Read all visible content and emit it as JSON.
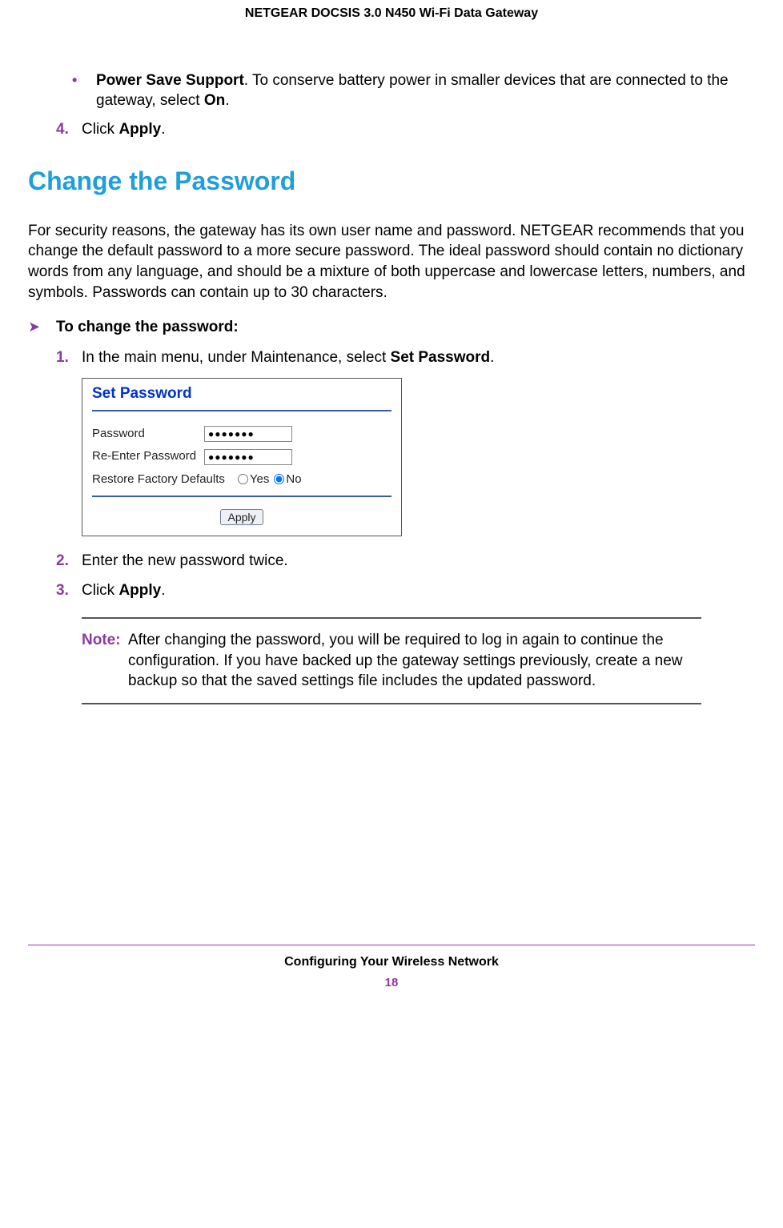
{
  "header": {
    "title": "NETGEAR DOCSIS 3.0 N450 Wi-Fi Data Gateway"
  },
  "bullet": {
    "label": "Power Save Support",
    "text": ". To conserve battery power in smaller devices that are connected to the gateway, select ",
    "on": "On",
    "period": "."
  },
  "step4": {
    "num": "4.",
    "pre": "Click ",
    "bold": "Apply",
    "post": "."
  },
  "heading": "Change the Password",
  "intro": "For security reasons, the gateway has its own user name and password. NETGEAR recommends that you change the default password to a more secure password. The ideal password should contain no dictionary words from any language, and should be a mixture of both uppercase and lowercase letters, numbers, and symbols. Passwords can contain up to 30 characters.",
  "proc": {
    "title": "To change the password:"
  },
  "s1": {
    "num": "1.",
    "pre": "In the main menu, under Maintenance, select ",
    "bold": "Set Password",
    "post": "."
  },
  "screenshot": {
    "title": "Set Password",
    "pw_label": "Password",
    "pw_value": "●●●●●●●",
    "rpw_label": "Re-Enter Password",
    "rpw_value": "●●●●●●●",
    "restore_label": "Restore Factory Defaults",
    "yes": "Yes",
    "no": "No",
    "apply": "Apply"
  },
  "s2": {
    "num": "2.",
    "text": "Enter the new password twice."
  },
  "s3": {
    "num": "3.",
    "pre": "Click ",
    "bold": "Apply",
    "post": "."
  },
  "note": {
    "label": "Note:",
    "text": "After changing the password, you will be required to log in again to continue the configuration. If you have backed up the gateway settings previously, create a new backup so that the saved settings file includes the updated password."
  },
  "footer": {
    "section": "Configuring Your Wireless Network",
    "page": "18"
  }
}
